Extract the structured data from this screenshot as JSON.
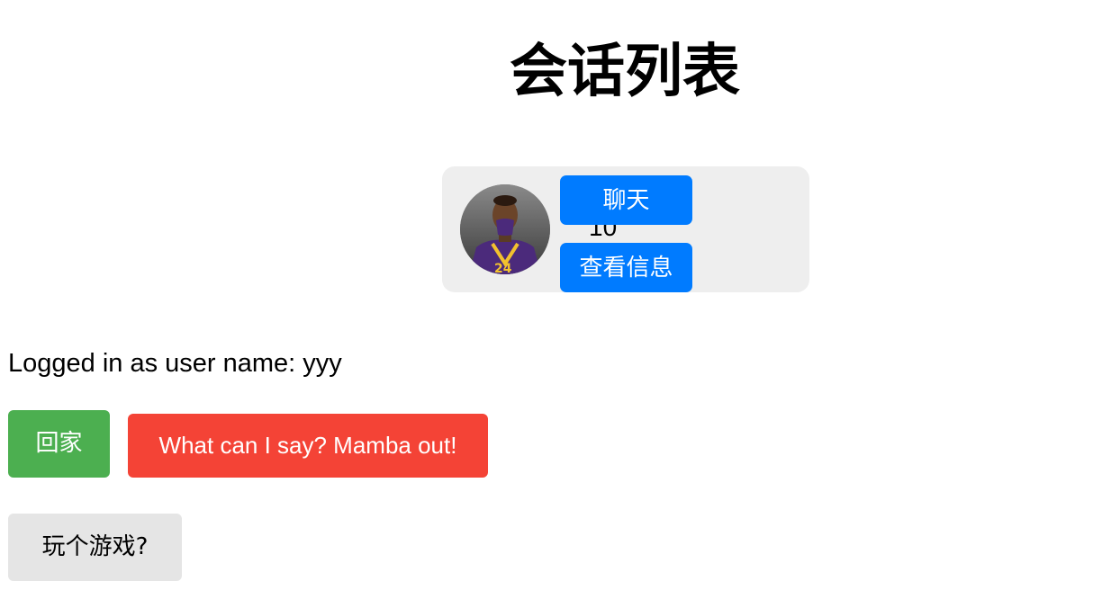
{
  "page": {
    "title": "会话列表"
  },
  "conversations": [
    {
      "count": "10",
      "chat_label": "聊天",
      "info_label": "查看信息"
    }
  ],
  "session": {
    "login_text": "Logged in as user name: yyy"
  },
  "actions": {
    "home_label": "回家",
    "mamba_label": "What can I say? Mamba out!",
    "game_label": "玩个游戏?"
  },
  "colors": {
    "primary": "#007bff",
    "success": "#4caf50",
    "danger": "#f44336",
    "neutral": "#e5e5e5",
    "card_bg": "#eeeeee"
  }
}
